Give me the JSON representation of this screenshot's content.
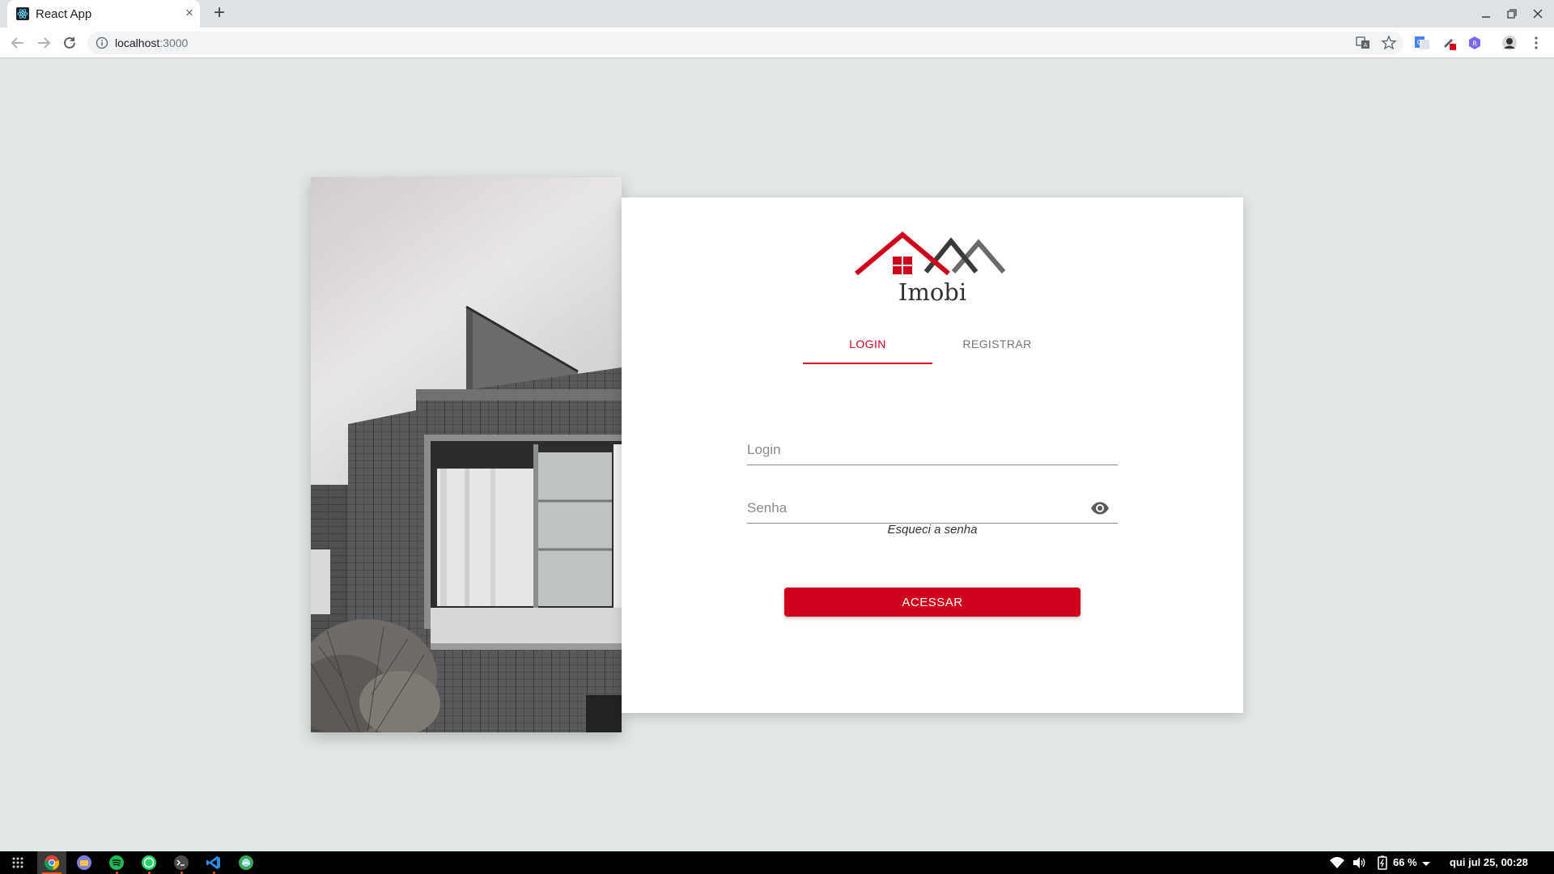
{
  "browser": {
    "tab_title": "React App",
    "tab_close": "×",
    "new_tab": "+",
    "url_host": "localhost",
    "url_port": ":3000"
  },
  "page": {
    "brand": "Imobi",
    "tabs": [
      {
        "label": "LOGIN",
        "active": true
      },
      {
        "label": "REGISTRAR",
        "active": false
      }
    ],
    "login_placeholder": "Login",
    "password_placeholder": "Senha",
    "forgot_password": "Esqueci a senha",
    "submit_label": "ACESSAR"
  },
  "colors": {
    "accent": "#d0021b",
    "background": "#e2e8e8",
    "card": "#ffffff"
  },
  "taskbar": {
    "apps": [
      "apps-grid-icon",
      "chrome-icon",
      "files-icon",
      "spotify-icon",
      "whatsapp-icon",
      "terminal-icon",
      "vscode-icon",
      "maps-icon"
    ],
    "battery": "66 %",
    "datetime": "qui jul 25, 00:28"
  }
}
